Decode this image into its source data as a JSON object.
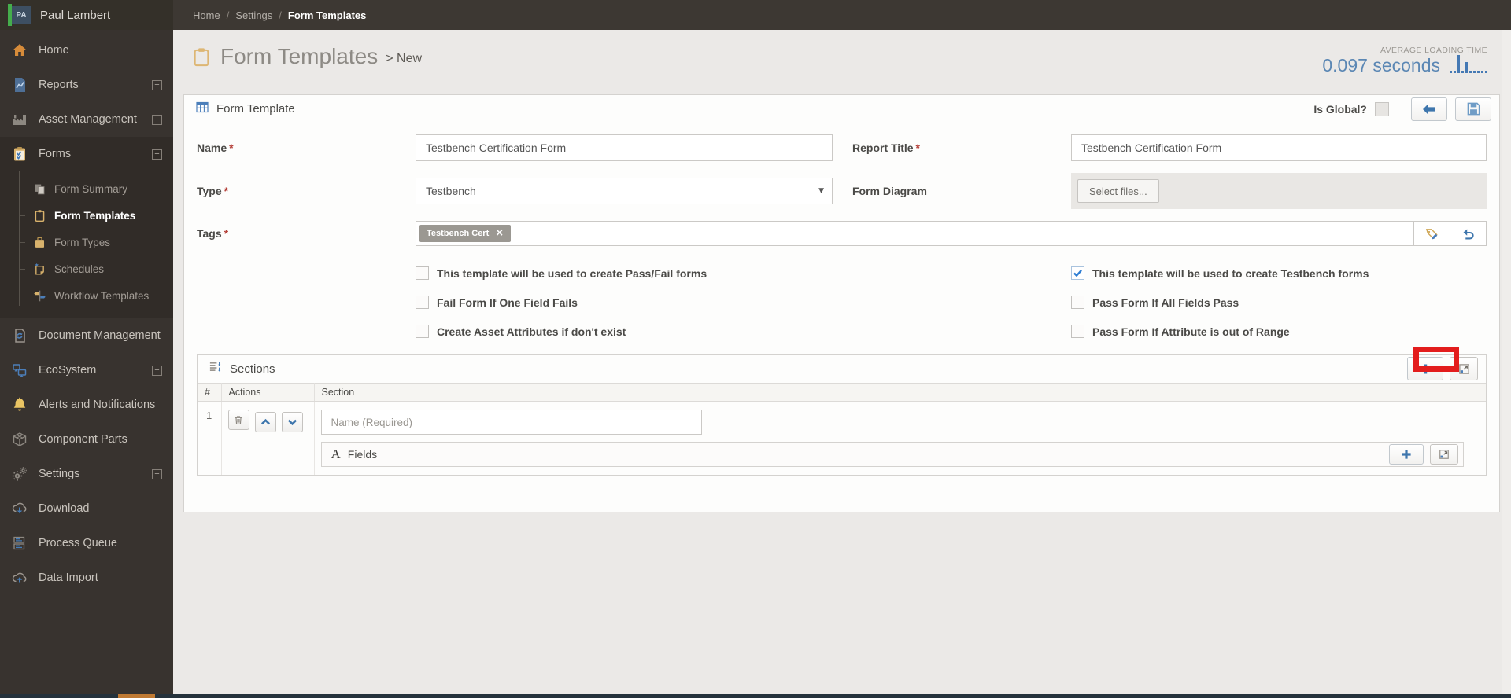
{
  "icons": {
    "expand": "+",
    "collapse": "−",
    "caret_down": "▼",
    "chip_close": "×",
    "fields_a": "A"
  },
  "user": {
    "initials": "PA",
    "name": "Paul Lambert"
  },
  "sidebar": {
    "items": [
      {
        "label": "Home",
        "icon": "home-icon"
      },
      {
        "label": "Reports",
        "icon": "reports-icon",
        "expandable": true
      },
      {
        "label": "Asset Management",
        "icon": "asset-management-icon",
        "expandable": true
      },
      {
        "label": "Forms",
        "icon": "forms-icon",
        "expandable": true,
        "expanded": true,
        "children": [
          {
            "label": "Form Summary",
            "icon": "form-summary-icon"
          },
          {
            "label": "Form Templates",
            "icon": "form-templates-icon",
            "active": true
          },
          {
            "label": "Form Types",
            "icon": "form-types-icon"
          },
          {
            "label": "Schedules",
            "icon": "schedules-icon"
          },
          {
            "label": "Workflow Templates",
            "icon": "workflow-templates-icon"
          }
        ]
      },
      {
        "label": "Document Management",
        "icon": "document-management-icon"
      },
      {
        "label": "EcoSystem",
        "icon": "ecosystem-icon",
        "expandable": true
      },
      {
        "label": "Alerts and Notifications",
        "icon": "alerts-icon"
      },
      {
        "label": "Component Parts",
        "icon": "component-parts-icon"
      },
      {
        "label": "Settings",
        "icon": "settings-icon",
        "expandable": true
      },
      {
        "label": "Download",
        "icon": "download-icon"
      },
      {
        "label": "Process Queue",
        "icon": "process-queue-icon"
      },
      {
        "label": "Data Import",
        "icon": "data-import-icon"
      }
    ]
  },
  "breadcrumb": {
    "items": [
      "Home",
      "Settings",
      "Form Templates"
    ],
    "separator": "/"
  },
  "page": {
    "title": "Form Templates",
    "subtitle": "> New"
  },
  "loading": {
    "label": "AVERAGE LOADING TIME",
    "value": "0.097 seconds",
    "sparkline": [
      3,
      3,
      23,
      3,
      14,
      3,
      3,
      3,
      3,
      3
    ]
  },
  "form_template_panel": {
    "title": "Form Template",
    "is_global_label": "Is Global?",
    "is_global_checked": false,
    "required_mark": "*",
    "fields": {
      "name": {
        "label": "Name",
        "value": "Testbench Certification Form"
      },
      "report_title": {
        "label": "Report Title",
        "value": "Testbench Certification Form"
      },
      "type": {
        "label": "Type",
        "value": "Testbench"
      },
      "form_diagram": {
        "label": "Form Diagram",
        "button": "Select files..."
      },
      "tags": {
        "label": "Tags",
        "chips": [
          {
            "text": "Testbench Cert"
          }
        ]
      }
    },
    "checkboxes": {
      "left": [
        {
          "label": "This template will be used to create Pass/Fail forms",
          "checked": false
        },
        {
          "label": "Fail Form If One Field Fails",
          "checked": false
        },
        {
          "label": "Create Asset Attributes if don't exist",
          "checked": false
        }
      ],
      "right": [
        {
          "label": "This template will be used to create Testbench forms",
          "checked": true
        },
        {
          "label": "Pass Form If All Fields Pass",
          "checked": false
        },
        {
          "label": "Pass Form If Attribute is out of Range",
          "checked": false
        }
      ]
    }
  },
  "sections_panel": {
    "title": "Sections",
    "columns": [
      "#",
      "Actions",
      "Section"
    ],
    "rows": [
      {
        "num": "1",
        "name_placeholder": "Name (Required)",
        "fields_title": "Fields"
      }
    ]
  }
}
